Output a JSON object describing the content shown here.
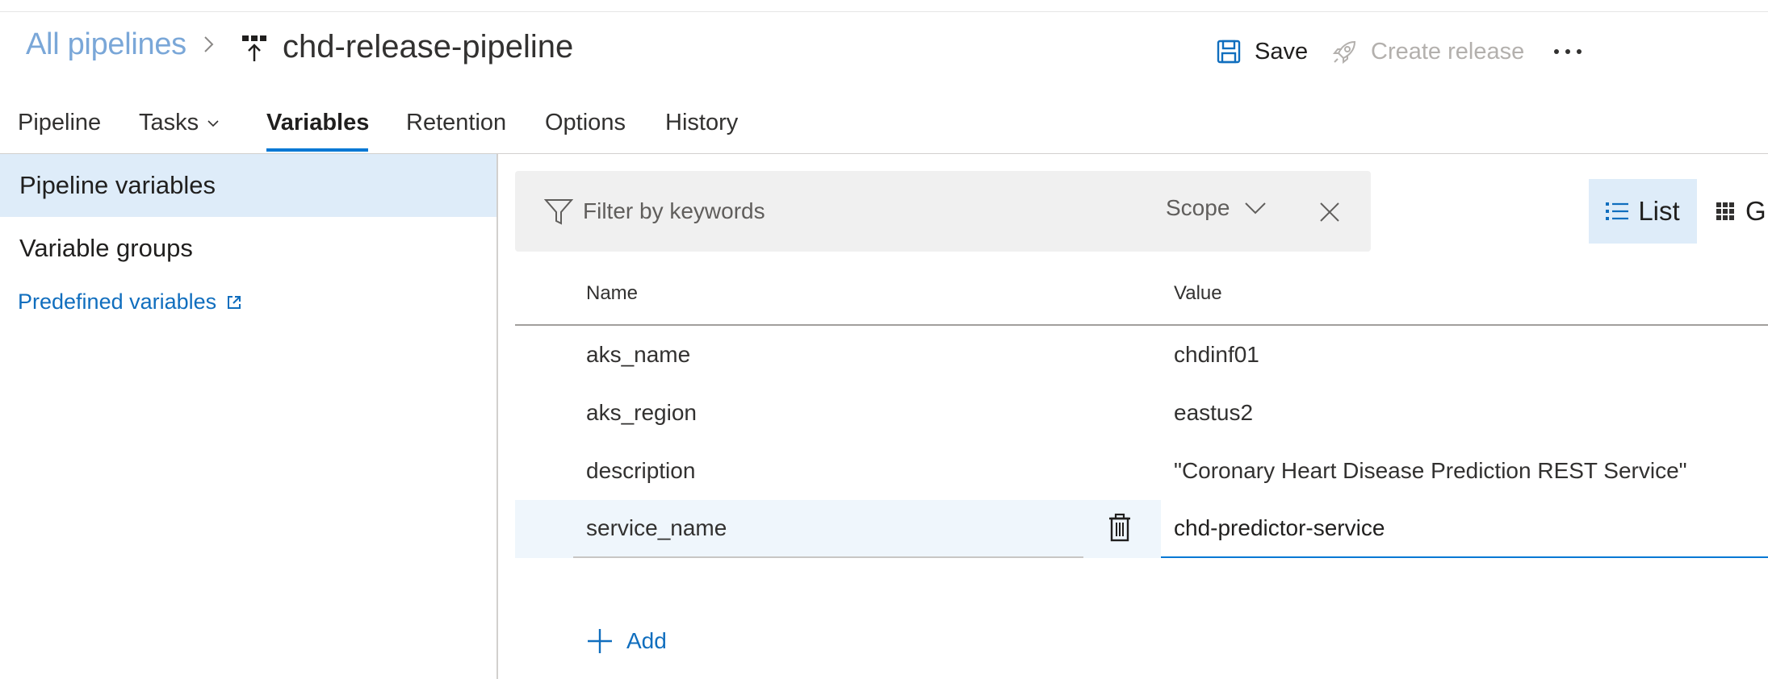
{
  "header": {
    "breadcrumb_root": "All pipelines",
    "pipeline_name": "chd-release-pipeline",
    "save_label": "Save",
    "create_release_label": "Create release",
    "more_icon": "more-horizontal-icon"
  },
  "tabs": [
    {
      "label": "Pipeline"
    },
    {
      "label": "Tasks"
    },
    {
      "label": "Variables"
    },
    {
      "label": "Retention"
    },
    {
      "label": "Options"
    },
    {
      "label": "History"
    }
  ],
  "active_tab": "Variables",
  "sidebar": {
    "items": [
      {
        "label": "Pipeline variables",
        "selected": true
      },
      {
        "label": "Variable groups",
        "selected": false
      }
    ],
    "predefined_link": "Predefined variables"
  },
  "filter": {
    "placeholder": "Filter by keywords",
    "scope_label": "Scope"
  },
  "view_toggle": {
    "list_label": "List",
    "grid_label": "G"
  },
  "table": {
    "columns": [
      "Name",
      "Value"
    ],
    "rows": [
      {
        "name": "aks_name",
        "value": "chdinf01"
      },
      {
        "name": "aks_region",
        "value": "eastus2"
      },
      {
        "name": "description",
        "value": "\"Coronary Heart Disease Prediction REST Service\""
      },
      {
        "name": "service_name",
        "value": "chd-predictor-service"
      }
    ]
  },
  "add_label": "Add",
  "colors": {
    "accent": "#0078d4",
    "link": "#106ebe",
    "selected_bg": "#deecf9",
    "disabled_text": "#b3b0ad"
  }
}
